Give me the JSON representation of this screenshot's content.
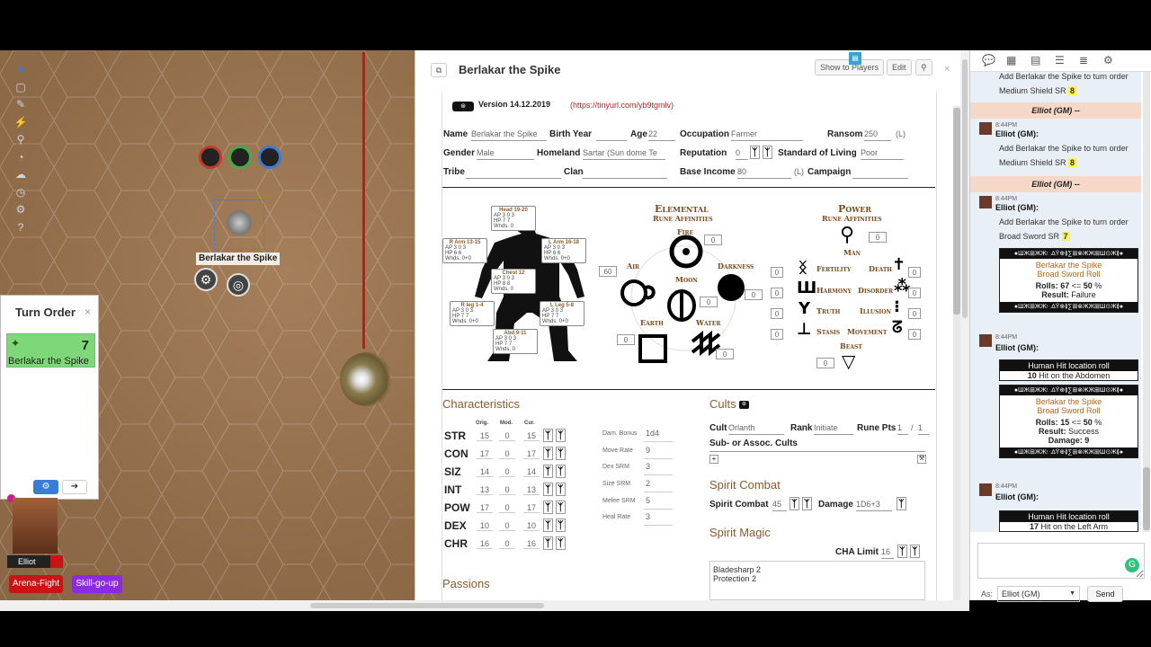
{
  "vtt": {
    "tools": [
      "select-icon",
      "layers-icon",
      "pen-icon",
      "pointer-icon",
      "zoom-icon",
      "measure-icon",
      "fog-icon",
      "clock-icon",
      "gear-icon",
      "help-icon"
    ],
    "token_label": "Berlakar the Spike",
    "turn_order": {
      "title": "Turn Order",
      "close": "×",
      "entries": [
        {
          "name": "Berlakar the Spike",
          "init": "7"
        }
      ]
    },
    "player": {
      "name": "Elliot"
    },
    "macros": [
      {
        "label": "Arena-Fight",
        "color": "#c81414"
      },
      {
        "label": "Skill-go-up",
        "color": "#8a2be2"
      }
    ]
  },
  "sheet": {
    "title": "Berlakar the Spike",
    "buttons": {
      "show": "Show to Players",
      "edit": "Edit"
    },
    "version": "Version 14.12.2019",
    "version_link": "(https://tinyurl.com/yb9tgmlv)",
    "header": {
      "name_label": "Name",
      "name": "Berlakar the Spike",
      "birth_label": "Birth Year",
      "age_label": "Age",
      "age": "22",
      "occ_label": "Occupation",
      "occ": "Farmer",
      "ransom_label": "Ransom",
      "ransom": "250",
      "ransom_unit": "(L)",
      "gender_label": "Gender",
      "gender": "Male",
      "homeland_label": "Homeland",
      "homeland": "Sartar (Sun dome Te",
      "rep_label": "Reputation",
      "rep": "0",
      "sol_label": "Standard of Living",
      "sol": "Poor",
      "tribe_label": "Tribe",
      "clan_label": "Clan",
      "income_label": "Base Income",
      "income": "80",
      "income_unit": "(L)",
      "campaign_label": "Campaign"
    },
    "hit_locations": [
      {
        "name": "Head 19-20",
        "ap": "3",
        "ap2": "0",
        "ap3": "3",
        "hp": "7",
        "hp2": "7",
        "w": "0"
      },
      {
        "name": "R Arm 13-15",
        "ap": "3",
        "ap2": "0",
        "ap3": "3",
        "hp": "6",
        "hp2": "6",
        "w": "0+0"
      },
      {
        "name": "L Arm 16-18",
        "ap": "3",
        "ap2": "0",
        "ap3": "3",
        "hp": "6",
        "hp2": "6",
        "w": "0+0"
      },
      {
        "name": "Chest 12",
        "ap": "3",
        "ap2": "0",
        "ap3": "3",
        "hp": "8",
        "hp2": "8",
        "w": "0"
      },
      {
        "name": "R leg 1-4",
        "ap": "3",
        "ap2": "0",
        "ap3": "3",
        "hp": "7",
        "hp2": "7",
        "w": "0+0"
      },
      {
        "name": "L Leg 5-8",
        "ap": "3",
        "ap2": "0",
        "ap3": "3",
        "hp": "7",
        "hp2": "7",
        "w": "0+0"
      },
      {
        "name": "Abd 9-11",
        "ap": "3",
        "ap2": "0",
        "ap3": "3",
        "hp": "7",
        "hp2": "7",
        "w": "0"
      }
    ],
    "elemental": {
      "title": "Elemental",
      "subtitle": "Rune Affinities",
      "runes": [
        {
          "name": "Fire",
          "val": "0"
        },
        {
          "name": "Air",
          "val": "60"
        },
        {
          "name": "Darkness",
          "val": "0"
        },
        {
          "name": "Moon",
          "val": "0"
        },
        {
          "name": "Earth",
          "val": "0"
        },
        {
          "name": "Water",
          "val": "0"
        }
      ]
    },
    "power": {
      "title": "Power",
      "subtitle": "Rune Affinities",
      "man": {
        "name": "Man",
        "val": "0"
      },
      "pairs": [
        {
          "l": "Fertility",
          "r": "Death",
          "lv": "0",
          "rv": "0"
        },
        {
          "l": "Harmony",
          "r": "Disorder",
          "lv": "0",
          "rv": "0"
        },
        {
          "l": "Truth",
          "r": "Illusion",
          "lv": "0",
          "rv": "0"
        },
        {
          "l": "Stasis",
          "r": "Movement",
          "lv": "0",
          "rv": "0"
        }
      ],
      "beast": {
        "name": "Beast",
        "val": "0"
      }
    },
    "characteristics": {
      "title": "Characteristics",
      "cols": [
        "Orig.",
        "Mod.",
        "Cur."
      ],
      "rows": [
        {
          "ab": "STR",
          "o": "15",
          "m": "0",
          "c": "15"
        },
        {
          "ab": "CON",
          "o": "17",
          "m": "0",
          "c": "17"
        },
        {
          "ab": "SIZ",
          "o": "14",
          "m": "0",
          "c": "14"
        },
        {
          "ab": "INT",
          "o": "13",
          "m": "0",
          "c": "13"
        },
        {
          "ab": "POW",
          "o": "17",
          "m": "0",
          "c": "17"
        },
        {
          "ab": "DEX",
          "o": "10",
          "m": "0",
          "c": "10"
        },
        {
          "ab": "CHR",
          "o": "16",
          "m": "0",
          "c": "16"
        }
      ],
      "derived": [
        {
          "k": "Dam. Bonus",
          "v": "1d4"
        },
        {
          "k": "Move Rate",
          "v": "9"
        },
        {
          "k": "Dex SRM",
          "v": "3"
        },
        {
          "k": "Size SRM",
          "v": "2"
        },
        {
          "k": "Melee SRM",
          "v": "5"
        },
        {
          "k": "Heal Rate",
          "v": "3"
        }
      ]
    },
    "cults": {
      "title": "Cults",
      "cult_label": "Cult",
      "cult": "Orlanth",
      "rank_label": "Rank",
      "rank": "Initiate",
      "rune_label": "Rune Pts",
      "rune": "1",
      "rune_max": "1",
      "sub_label": "Sub- or Assoc. Cults"
    },
    "spirit_combat": {
      "title": "Spirit Combat",
      "label": "Spirit Combat",
      "val": "45",
      "dmg_label": "Damage",
      "dmg": "1D6+3"
    },
    "spirit_magic": {
      "title": "Spirit Magic",
      "cha_label": "CHA Limit",
      "cha": "16",
      "spells": [
        "Bladesharp 2",
        "Protection 2"
      ]
    },
    "passions_title": "Passions"
  },
  "chat": {
    "msg0_text": "Add Berlakar the Spike to turn order",
    "msg0_item": "Medium Shield SR",
    "msg0_sr": "8",
    "emote1": "Elliot (GM) --",
    "m1_time": "8:44PM",
    "m1_who": "Elliot (GM):",
    "m1_text": "Add Berlakar the Spike to turn order",
    "m1_item": "Medium Shield SR",
    "m1_sr": "8",
    "emote2": "Elliot (GM) --",
    "m2_time": "8:44PM",
    "m2_who": "Elliot (GM):",
    "m2_text": "Add Berlakar the Spike to turn order",
    "m2_item": "Broad Sword SR",
    "m2_sr": "7",
    "roll1": {
      "name": "Berlakar the Spike",
      "skill": "Broad Sword Roll",
      "rolls_label": "Rolls:",
      "roll": "67",
      "op": "<=",
      "target": "50",
      "pct": "%",
      "result_label": "Result:",
      "result": "Failure"
    },
    "m3_time": "8:44PM",
    "m3_who": "Elliot (GM):",
    "hit1": {
      "title": "Human Hit location roll",
      "num": "10",
      "loc": "Hit on the Abdomen"
    },
    "roll2": {
      "name": "Berlakar the Spike",
      "skill": "Broad Sword Roll",
      "rolls_label": "Rolls:",
      "roll": "15",
      "op": "<=",
      "target": "50",
      "pct": "%",
      "result_label": "Result:",
      "result": "Success",
      "dmg_label": "Damage:",
      "dmg": "9"
    },
    "m4_time": "8:44PM",
    "m4_who": "Elliot (GM):",
    "hit2": {
      "title": "Human Hit location roll",
      "num": "17",
      "loc": "Hit on the Left Arm"
    },
    "band": "●ШЖ⊞ЖЖ፧∴∆Ϋ⊕≬∑⊞⊗ЖЖ⊞Ш⊙Ж≬●",
    "as_label": "As:",
    "as_value": "Elliot (GM)",
    "send": "Send"
  }
}
